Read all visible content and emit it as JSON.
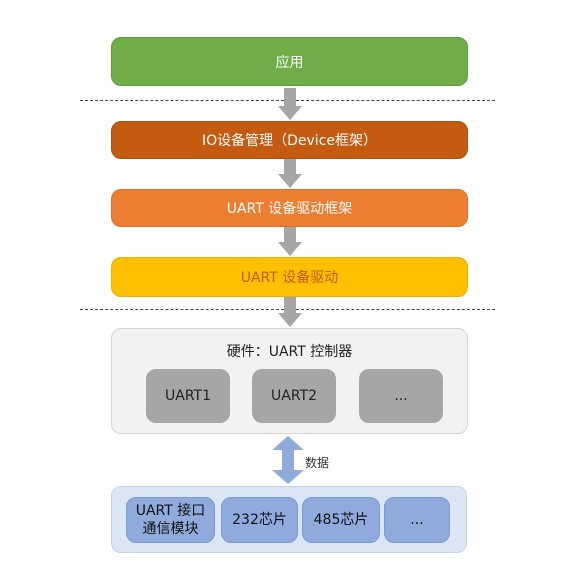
{
  "layers": {
    "app": "应用",
    "io_manager": "IO设备管理（Device框架）",
    "uart_framework": "UART 设备驱动框架",
    "uart_driver": "UART 设备驱动"
  },
  "hardware": {
    "title": "硬件：UART 控制器",
    "items": [
      "UART1",
      "UART2",
      "..."
    ]
  },
  "link_label": "数据",
  "interfaces": {
    "uart_module_line1": "UART 接口",
    "uart_module_line2": "通信模块",
    "chip_232": "232芯片",
    "chip_485": "485芯片",
    "more": "..."
  },
  "colors": {
    "app": "#70ad47",
    "io_manager": "#c55a11",
    "uart_framework": "#ed7d31",
    "uart_driver": "#ffc000",
    "hardware_bg": "#f2f2f2",
    "hardware_item": "#a6a6a6",
    "interface_bg": "#dbe6f4",
    "interface_item": "#8faadc",
    "arrow": "#a6a6a6",
    "data_arrow": "#8faadc"
  }
}
